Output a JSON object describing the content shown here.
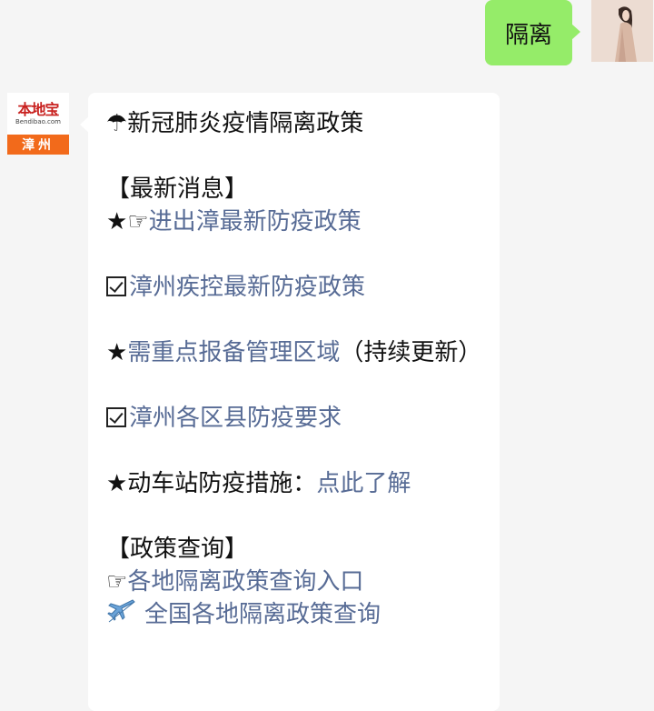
{
  "user_message": {
    "text": "隔离"
  },
  "bot": {
    "logo": {
      "main": "本地宝",
      "sub": "Bendibao.com",
      "city": "漳州"
    },
    "message": {
      "title_icon": "umbrella-icon",
      "title": "☂新冠肺炎疫情隔离政策",
      "section_latest": "【最新消息】",
      "item1_prefix": "★☞",
      "item1_link": "进出漳最新防疫政策",
      "item2_link": "漳州疾控最新防疫政策",
      "item3_prefix": "★",
      "item3_link": "需重点报备管理区域",
      "item3_suffix": "（持续更新）",
      "item4_link": "漳州各区县防疫要求",
      "item5_text": "★动车站防疫措施：",
      "item5_link": "点此了解",
      "section_policy": "【政策查询】",
      "item6_prefix": "☞",
      "item6_link": "各地隔离政策查询入口",
      "item7_link": "全国各地隔离政策查询"
    }
  },
  "colors": {
    "background": "#f5f5f5",
    "user_bubble": "#95ec69",
    "bot_bubble": "#ffffff",
    "link": "#576b95",
    "logo_red": "#c8201e",
    "logo_orange": "#f26a1b"
  }
}
